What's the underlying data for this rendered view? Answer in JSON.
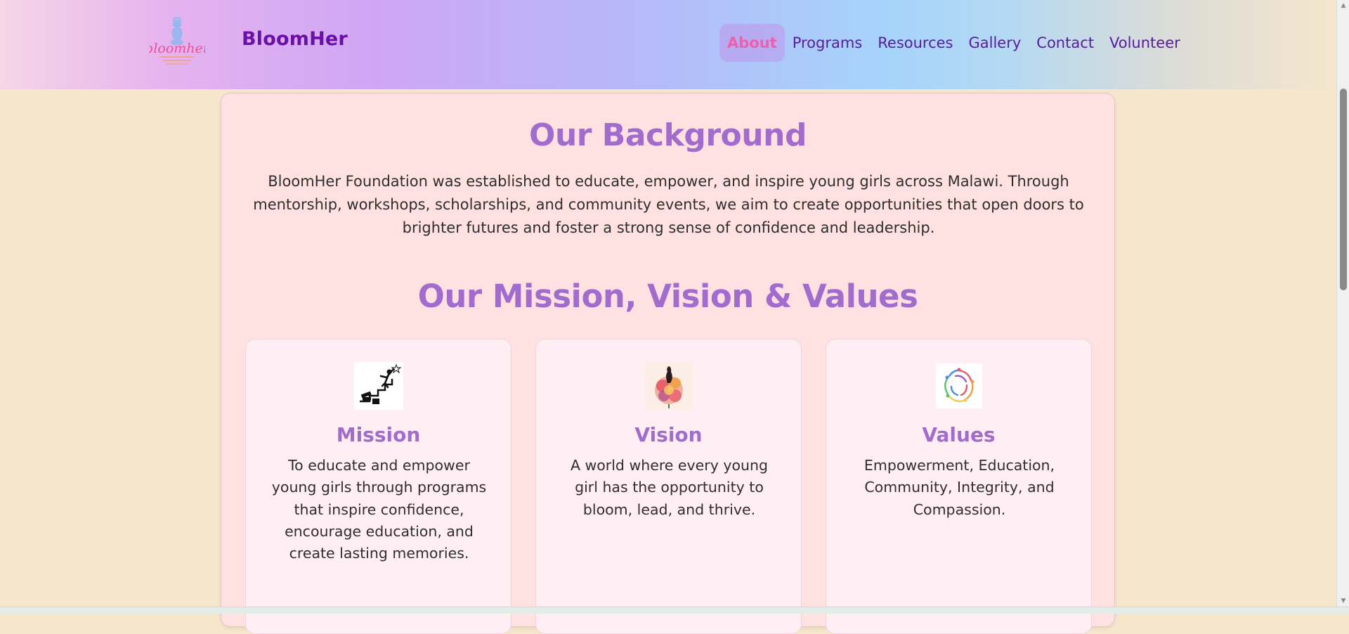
{
  "header": {
    "brand": "BloomHer",
    "logo_text": "bloomher",
    "nav": [
      "About",
      "Programs",
      "Resources",
      "Gallery",
      "Contact",
      "Volunteer"
    ],
    "active_nav": "About"
  },
  "background": {
    "title": "Our Background",
    "text": "BloomHer Foundation was established to educate, empower, and inspire young girls across Malawi. Through mentorship, workshops, scholarships, and community events, we aim to create opportunities that open doors to brighter futures and foster a strong sense of confidence and leadership."
  },
  "mvv": {
    "title": "Our Mission, Vision & Values",
    "cards": [
      {
        "heading": "Mission",
        "text": "To educate and empower young girls through programs that inspire confidence, encourage education, and create lasting memories.",
        "icon": "climber-icon"
      },
      {
        "heading": "Vision",
        "text": "A world where every young girl has the opportunity to bloom, lead, and thrive.",
        "icon": "flower-woman-icon"
      },
      {
        "heading": "Values",
        "text": "Empowerment, Education, Community, Integrity, and Compassion.",
        "icon": "unity-circle-icon"
      }
    ]
  },
  "colors": {
    "brand": "#6a0fa8",
    "accent_heading": "#a26ccf",
    "nav_active": "#ef5fae",
    "page_bg": "#f5e6cc",
    "card_bg": "#ffe1e1"
  }
}
